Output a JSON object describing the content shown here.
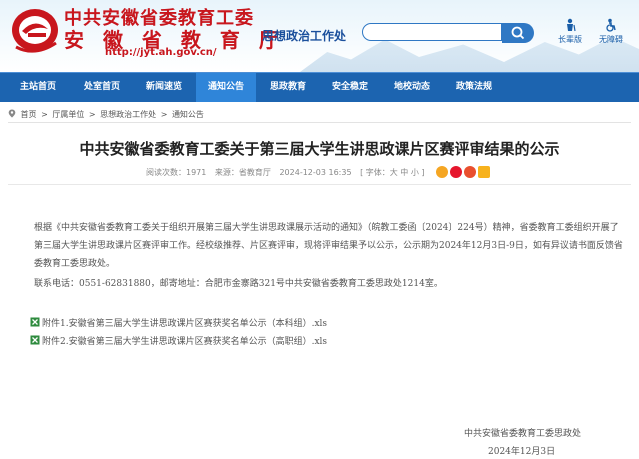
{
  "header": {
    "title_cn1": "中共安徽省委教育工委",
    "title_cn2": "安 徽 省 教 育 厅",
    "url": "http://jyt.ah.gov.cn/",
    "dept": "思想政治工作处",
    "search_placeholder": "",
    "tools": [
      {
        "label": "长辈版",
        "icon": "elder-icon"
      },
      {
        "label": "无障碍",
        "icon": "accessibility-icon"
      }
    ],
    "brand_color": "#c8161d",
    "nav_color": "#1c64b0"
  },
  "nav": [
    {
      "label": "主站首页"
    },
    {
      "label": "处室首页"
    },
    {
      "label": "新闻速览"
    },
    {
      "label": "通知公告",
      "active": true
    },
    {
      "label": "思政教育"
    },
    {
      "label": "安全稳定"
    },
    {
      "label": "地校动态"
    },
    {
      "label": "政策法规"
    }
  ],
  "breadcrumb": {
    "home": "首页",
    "level2": "厅属单位",
    "level3": "思想政治工作处",
    "level4": "通知公告",
    "sep": ">"
  },
  "article": {
    "title": "中共安徽省委教育工委关于第三届大学生讲思政课片区赛评审结果的公示",
    "views": "阅读次数：1971",
    "source": "来源：省教育厅",
    "date": "2024-12-03 16:35",
    "font_label": "[ 字体：大 中 小 ]",
    "share_icons": [
      "qzone-icon",
      "weibo-icon",
      "wechat-icon",
      "favorite-icon"
    ],
    "para1": "根据《中共安徽省委教育工委关于组织开展第三届大学生讲思政课展示活动的通知》（皖教工委函〔2024〕224号）精神，省委教育工委组织开展了第三届大学生讲思政课片区赛评审工作。经校级推荐、片区赛评审，现将评审结果予以公示，公示期为2024年12月3日-9日，如有异议请书面反馈省委教育工委思政处。",
    "contact": "联系电话：0551-62831880，邮寄地址：合肥市金寨路321号中共安徽省委教育工委思政处1214室。",
    "attachments": [
      "附件1.安徽省第三届大学生讲思政课片区赛获奖名单公示（本科组）.xls",
      "附件2.安徽省第三届大学生讲思政课片区赛获奖名单公示（高职组）.xls"
    ],
    "signature": "中共安徽省委教育工委思政处",
    "sign_date": "2024年12月3日"
  }
}
